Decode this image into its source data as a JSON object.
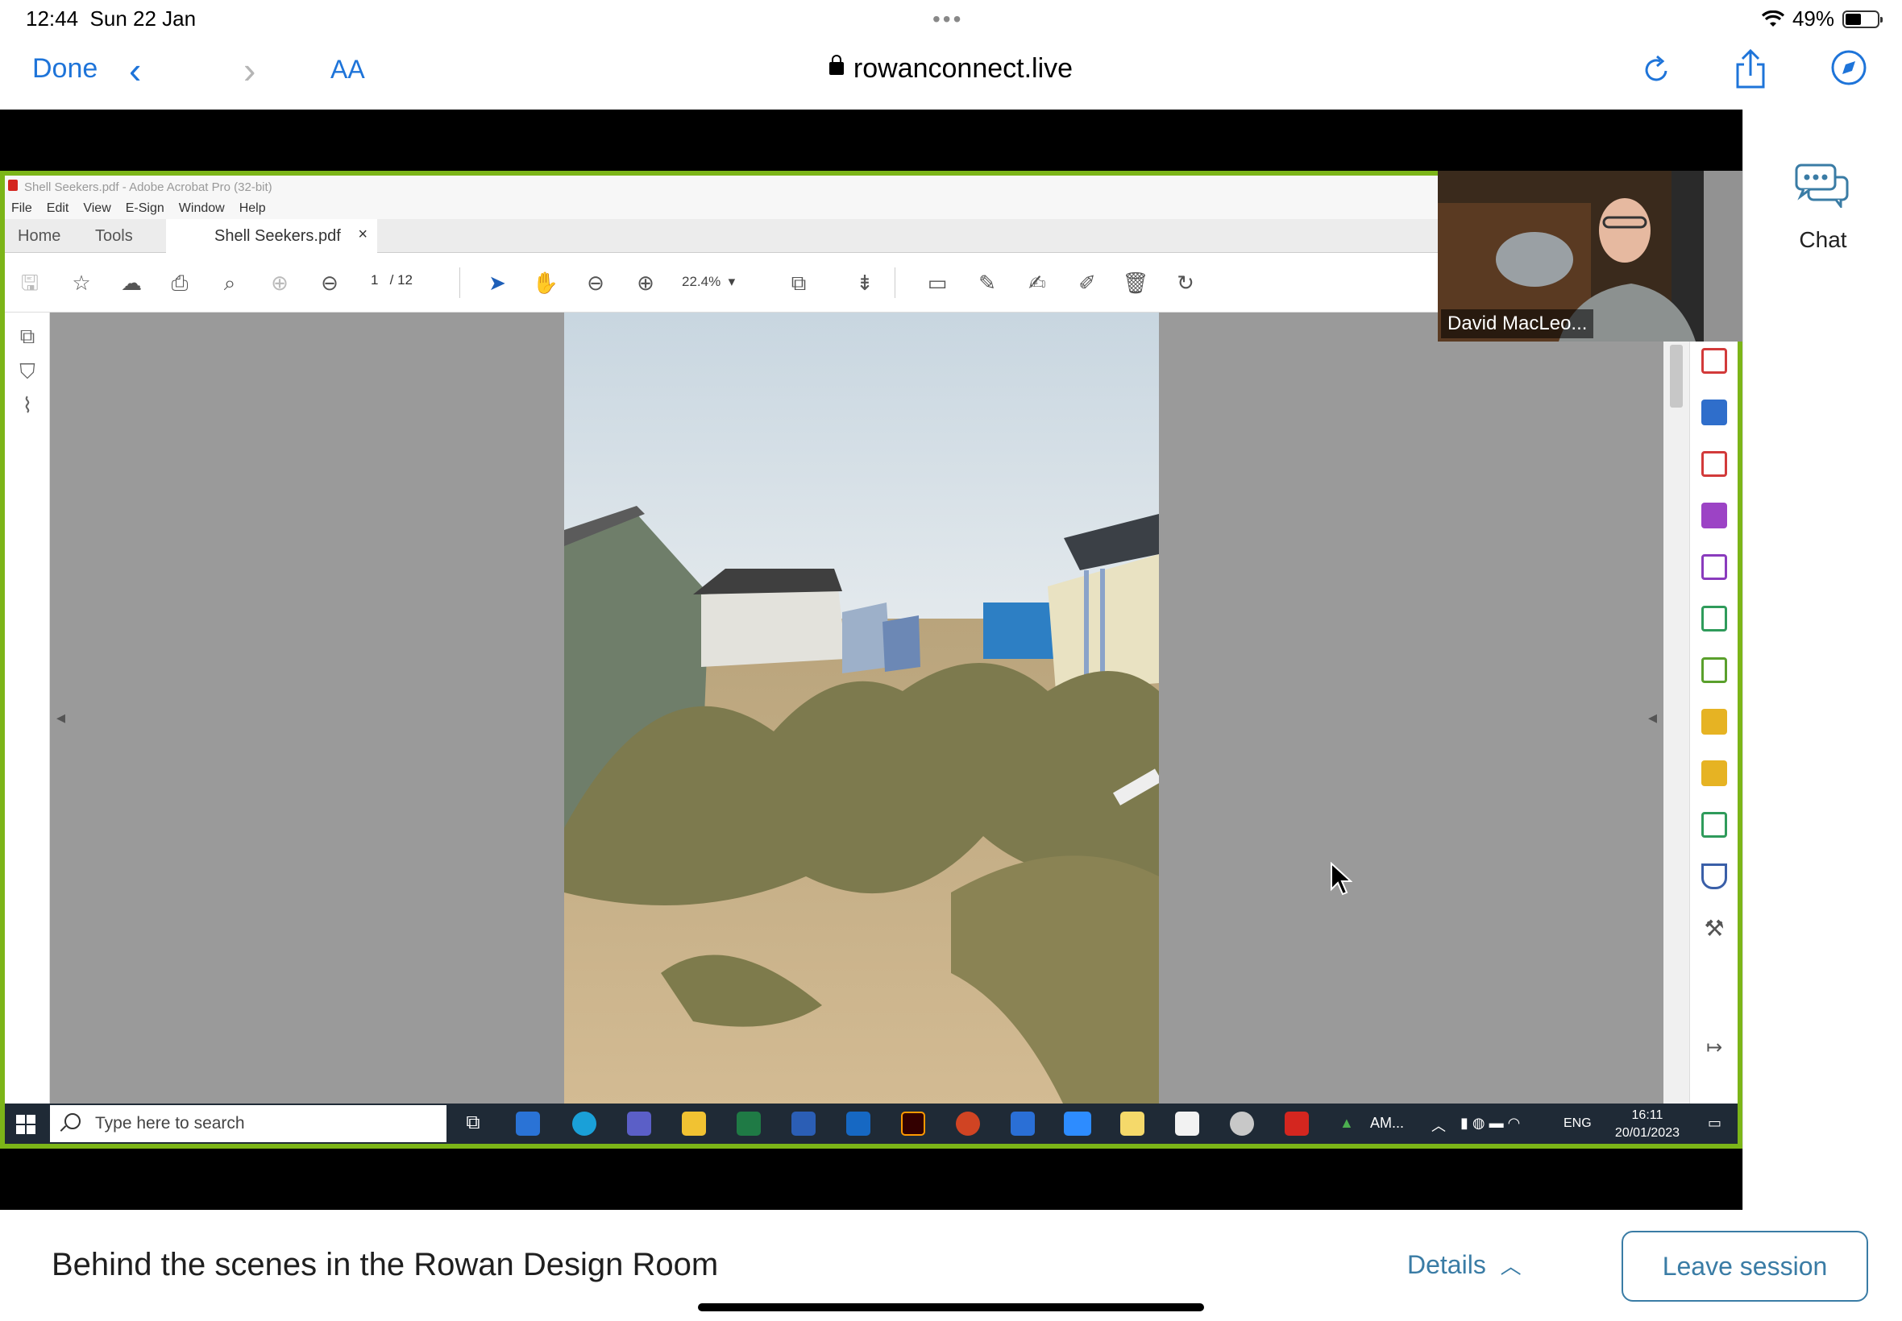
{
  "status_bar": {
    "time": "12:44",
    "date": "Sun 22 Jan",
    "battery": "49%",
    "battery_level": 0.49
  },
  "browser": {
    "done_label": "Done",
    "text_size_label": "AA",
    "url": "rowanconnect.live"
  },
  "chat": {
    "label": "Chat"
  },
  "shared_screen": {
    "window_title": "Shell Seekers.pdf - Adobe Acrobat Pro (32-bit)",
    "menu": [
      "File",
      "Edit",
      "View",
      "E-Sign",
      "Window",
      "Help"
    ],
    "tabs": {
      "home": "Home",
      "tools": "Tools",
      "document": "Shell Seekers.pdf"
    },
    "page_current": "1",
    "page_total": "/ 12",
    "zoom": "22.4%",
    "taskbar": {
      "search_placeholder": "Type here to search",
      "tray_app": "AM...",
      "language": "ENG",
      "time": "16:11",
      "date": "20/01/2023"
    }
  },
  "participant": {
    "name": "David MacLeo..."
  },
  "session": {
    "title": "Behind the scenes in the Rowan Design Room",
    "details_label": "Details",
    "leave_label": "Leave session"
  },
  "colors": {
    "accent": "#1e74d9",
    "session_accent": "#3a7ca5",
    "share_border": "#7cb518"
  }
}
